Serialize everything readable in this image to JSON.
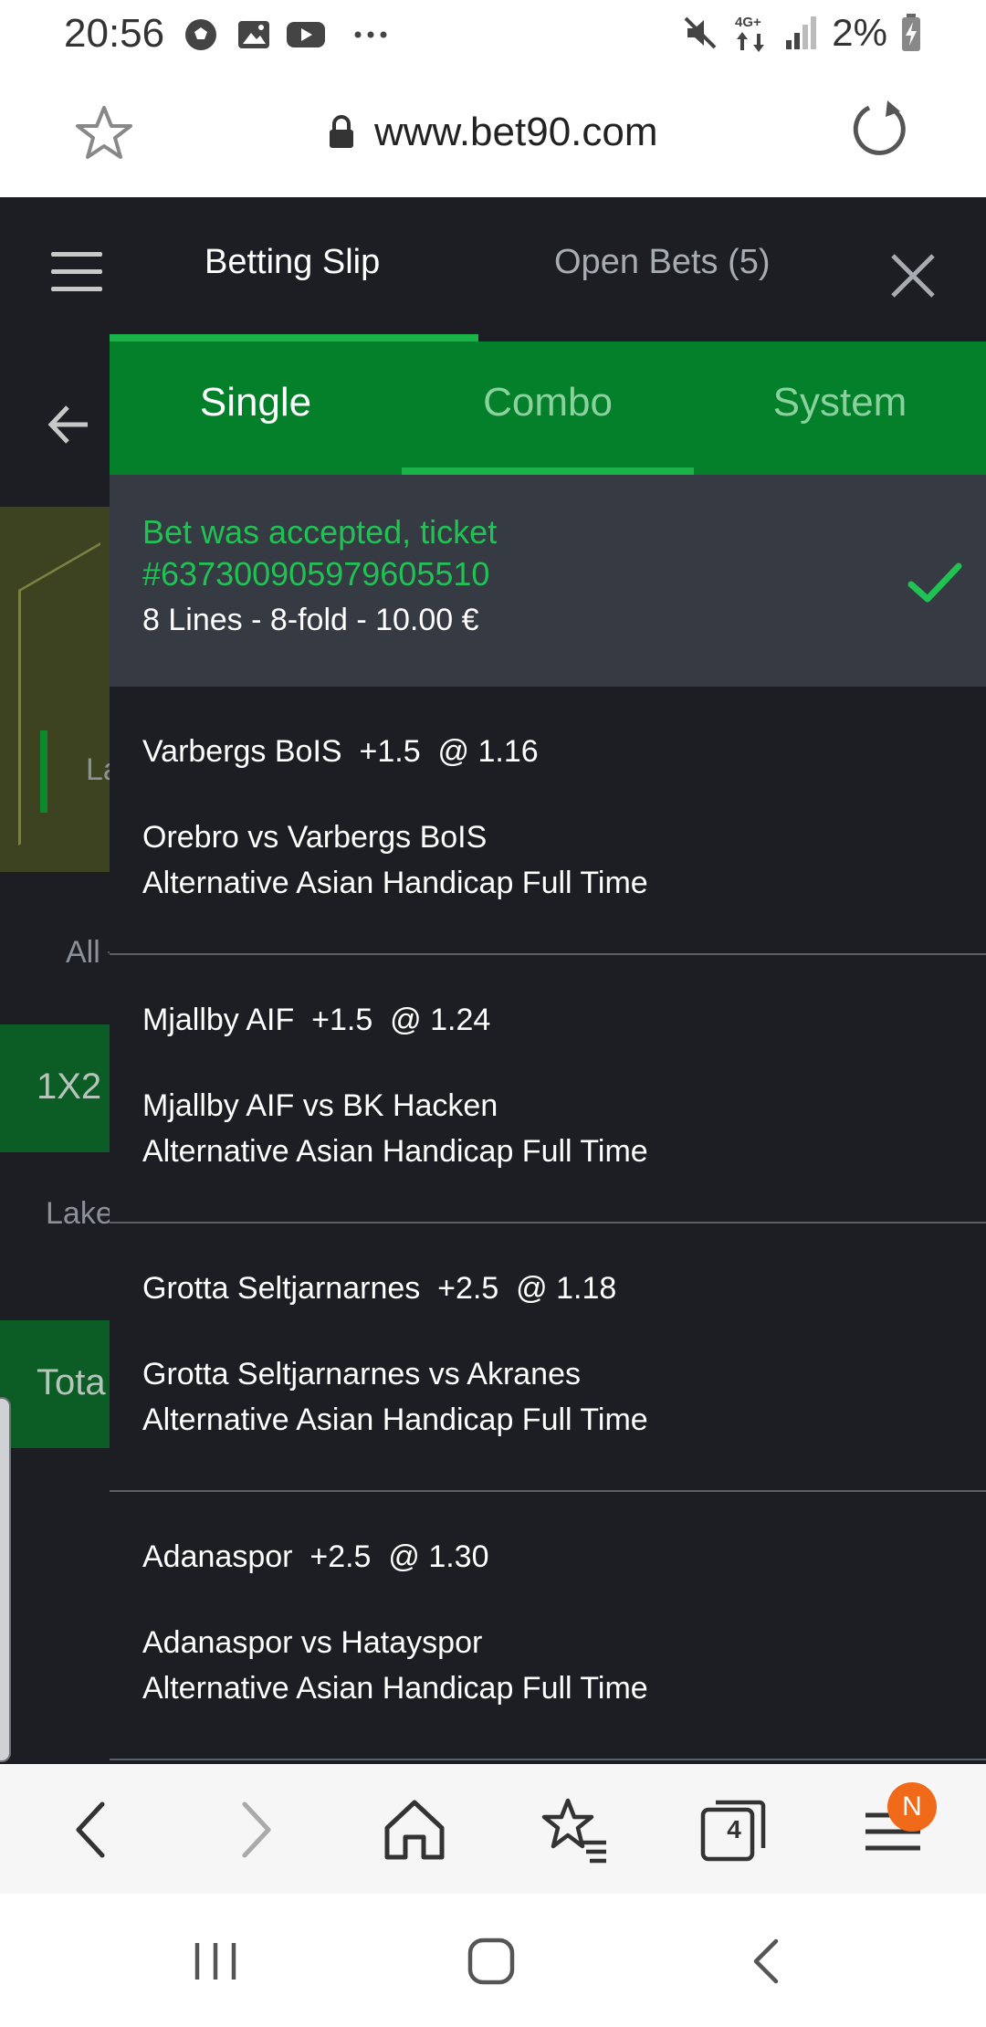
{
  "status_bar": {
    "time": "20:56",
    "left_icons": [
      "soccer-ball-icon",
      "gallery-icon",
      "youtube-icon",
      "more-dots-icon"
    ],
    "right_icons": [
      "mute-icon",
      "4g-data-icon",
      "signal-icon",
      "battery-charging-icon"
    ],
    "network": "4G+",
    "battery": "2%"
  },
  "browser": {
    "url": "www.bet90.com",
    "toolbar": {
      "tabs_count": "4",
      "menu_badge": "N"
    }
  },
  "underlay": {
    "all_label": "All",
    "market_1x2": "1X2",
    "team_partial": "Lake",
    "total_partial": "Tota",
    "field_partial": "La"
  },
  "slip": {
    "tabs": [
      {
        "label": "Betting Slip",
        "active": true
      },
      {
        "label": "Open Bets (5)",
        "active": false
      }
    ],
    "bet_types": [
      {
        "label": "Single",
        "active": true
      },
      {
        "label": "Combo",
        "active": false
      },
      {
        "label": "System",
        "active": false
      }
    ],
    "accepted": {
      "message_line1": "Bet was accepted, ticket",
      "ticket": "#637300905979605510",
      "summary": "8 Lines - 8-fold - 10.00 €"
    },
    "bets": [
      {
        "pick": "Varbergs BoIS  +1.5  @ 1.16",
        "match": "Orebro vs Varbergs BoIS",
        "market": "Alternative Asian Handicap Full Time"
      },
      {
        "pick": "Mjallby AIF  +1.5  @ 1.24",
        "match": "Mjallby AIF vs BK Hacken",
        "market": "Alternative Asian Handicap Full Time"
      },
      {
        "pick": "Grotta Seltjarnarnes  +2.5  @ 1.18",
        "match": "Grotta Seltjarnarnes vs Akranes",
        "market": "Alternative Asian Handicap Full Time"
      },
      {
        "pick": "Adanaspor  +2.5  @ 1.30",
        "match": "Adanaspor vs Hatayspor",
        "market": "Alternative Asian Handicap Full Time"
      }
    ]
  },
  "colors": {
    "accent_green": "#038029",
    "success_green": "#1fc253",
    "panel_dark": "#1c1e24",
    "accepted_bg": "#363a43",
    "badge_orange": "#f06a1a"
  }
}
